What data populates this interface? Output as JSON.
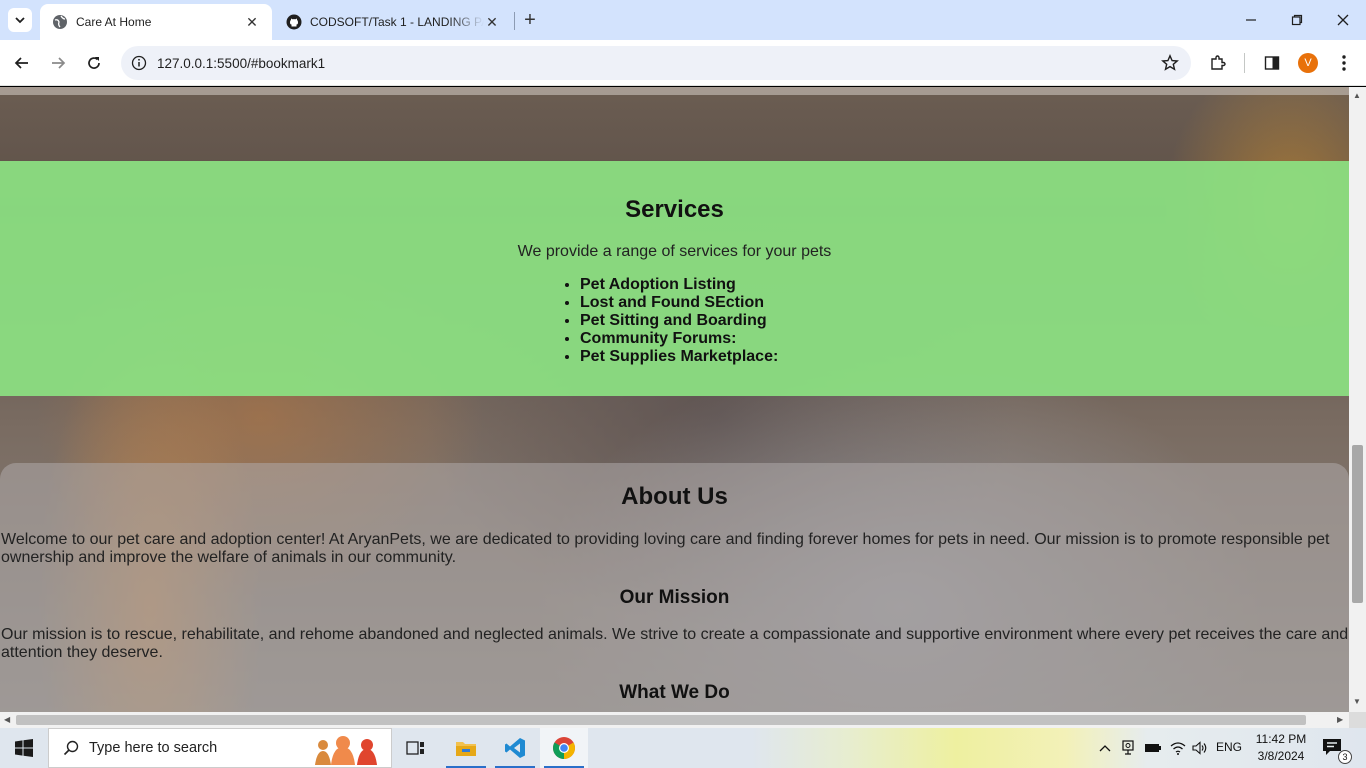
{
  "browser": {
    "tabs": [
      {
        "title": "Care At Home",
        "active": true
      },
      {
        "title": "CODSOFT/Task 1 - LANDING PAGE",
        "active": false
      }
    ],
    "url": "127.0.0.1:5500/#bookmark1",
    "profile_initial": "V",
    "profile_color": "#e8710a"
  },
  "page": {
    "services": {
      "title": "Services",
      "lead": "We provide a range of services for your pets",
      "items": [
        "Pet Adoption Listing",
        "Lost and Found SEction",
        "Pet Sitting and Boarding",
        "Community Forums:",
        "Pet Supplies Marketplace:"
      ],
      "band_color": "#8ce182"
    },
    "about": {
      "title": "About Us",
      "intro": "Welcome to our pet care and adoption center! At AryanPets, we are dedicated to providing loving care and finding forever homes for pets in need. Our mission is to promote responsible pet ownership and improve the welfare of animals in our community.",
      "mission_title": "Our Mission",
      "mission_text": "Our mission is to rescue, rehabilitate, and rehome abandoned and neglected animals. We strive to create a compassionate and supportive environment where every pet receives the care and attention they deserve.",
      "what_title": "What We Do"
    }
  },
  "taskbar": {
    "search_placeholder": "Type here to search",
    "language": "ENG",
    "time": "11:42 PM",
    "date": "3/8/2024",
    "notification_count": "3"
  }
}
